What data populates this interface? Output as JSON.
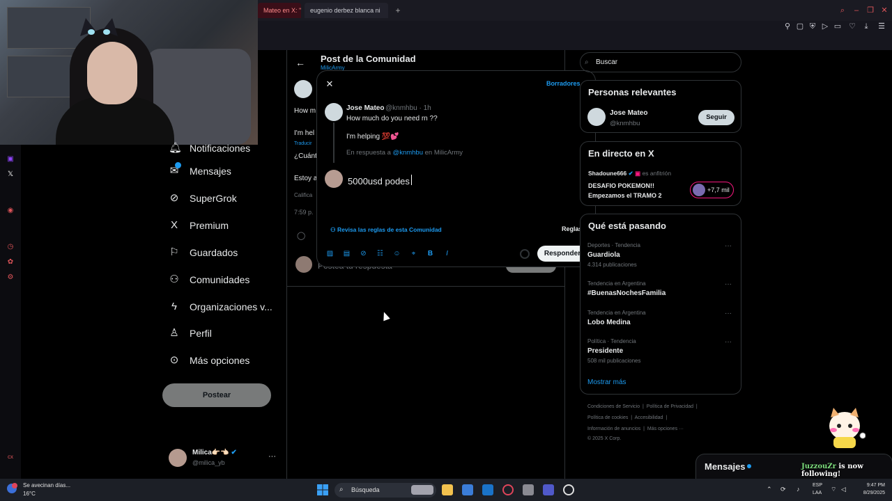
{
  "browser": {
    "tabs": [
      {
        "label": "Mateo en X: \"H"
      },
      {
        "label": "eugenio derbez blanca ni"
      }
    ],
    "new_tab": "+"
  },
  "left_nav": {
    "items": [
      {
        "label": "Notificaciones",
        "icon": "bell-icon"
      },
      {
        "label": "Mensajes",
        "icon": "mail-icon"
      },
      {
        "label": "SuperGrok",
        "icon": "grok-icon"
      },
      {
        "label": "Premium",
        "icon": "x-logo-icon"
      },
      {
        "label": "Guardados",
        "icon": "bookmark-icon"
      },
      {
        "label": "Comunidades",
        "icon": "communities-icon"
      },
      {
        "label": "Organizaciones v...",
        "icon": "lightning-icon"
      },
      {
        "label": "Perfil",
        "icon": "person-icon"
      },
      {
        "label": "Más opciones",
        "icon": "more-circle-icon"
      }
    ],
    "post_button": "Postear",
    "account": {
      "name": "Milica👉🏻👈🏻",
      "handle": "@milica_yb"
    }
  },
  "main": {
    "header_title": "Post de la Comunidad",
    "header_sub": "MilicArmy",
    "fragments": [
      "How m",
      "I'm hel",
      "Traducir",
      "¿Cuánt",
      "Estoy a",
      "Califica",
      "7:59 p."
    ],
    "reply_placeholder": "Postea tu respuesta",
    "reply_button": "Responder"
  },
  "modal": {
    "drafts": "Borradores",
    "quoted": {
      "name": "Jose Mateo",
      "handle": "@knmhbu · 1h",
      "text1": "How much do you need rn ??",
      "text2": "I'm helping 💯💕",
      "replying_prefix": "En respuesta a",
      "replying_handle": "@knmhbu",
      "replying_suffix": "en MilicArmy"
    },
    "input_value": "5000usd podes",
    "rules_link": "Revisa las reglas de esta Comunidad",
    "rules_button": "Reglas",
    "respond_button": "Responder"
  },
  "right": {
    "search_placeholder": "Buscar",
    "relevant_title": "Personas relevantes",
    "relevant_person": {
      "name": "Jose Mateo",
      "handle": "@knmhbu",
      "follow": "Seguir"
    },
    "live_title": "En directo en X",
    "live": {
      "host": "Shadoune666",
      "host_role": "es anfitrión",
      "line1": "DESAFIO POKEMON!!",
      "line2": "Empezamos el TRAMO 2",
      "count": "+7,7 mil"
    },
    "trends_title": "Qué está pasando",
    "trends": [
      {
        "meta": "Deportes · Tendencia",
        "name": "Guardiola",
        "count": "4.314 publicaciones"
      },
      {
        "meta": "Tendencia en Argentina",
        "name": "#BuenasNochesFamilia",
        "count": ""
      },
      {
        "meta": "Tendencia en Argentina",
        "name": "Lobo Medina",
        "count": ""
      },
      {
        "meta": "Política · Tendencia",
        "name": "Presidente",
        "count": "508 mil publicaciones"
      }
    ],
    "show_more": "Mostrar más",
    "footer": {
      "l1a": "Condiciones de Servicio",
      "l1b": "Política de Privacidad",
      "l2a": "Política de cookies",
      "l2b": "Accesibilidad",
      "l3a": "Información de anuncios",
      "l3b": "Más opciones ···",
      "l4": "© 2025 X Corp."
    }
  },
  "messages_drawer": {
    "title": "Mensajes"
  },
  "overlay": {
    "follower": "JuzzouZr",
    "follow_text": " is now following!"
  },
  "taskbar": {
    "weather_line1": "Se avecinan días...",
    "weather_line2": "16°C",
    "search": "Búsqueda",
    "lang1": "ESP",
    "lang2": "LAA",
    "time": "9:47 PM",
    "date": "8/29/2025"
  },
  "colors": {
    "accent": "#1d9bf0",
    "background": "#000000",
    "border": "#2f3336",
    "live": "#f91880"
  }
}
